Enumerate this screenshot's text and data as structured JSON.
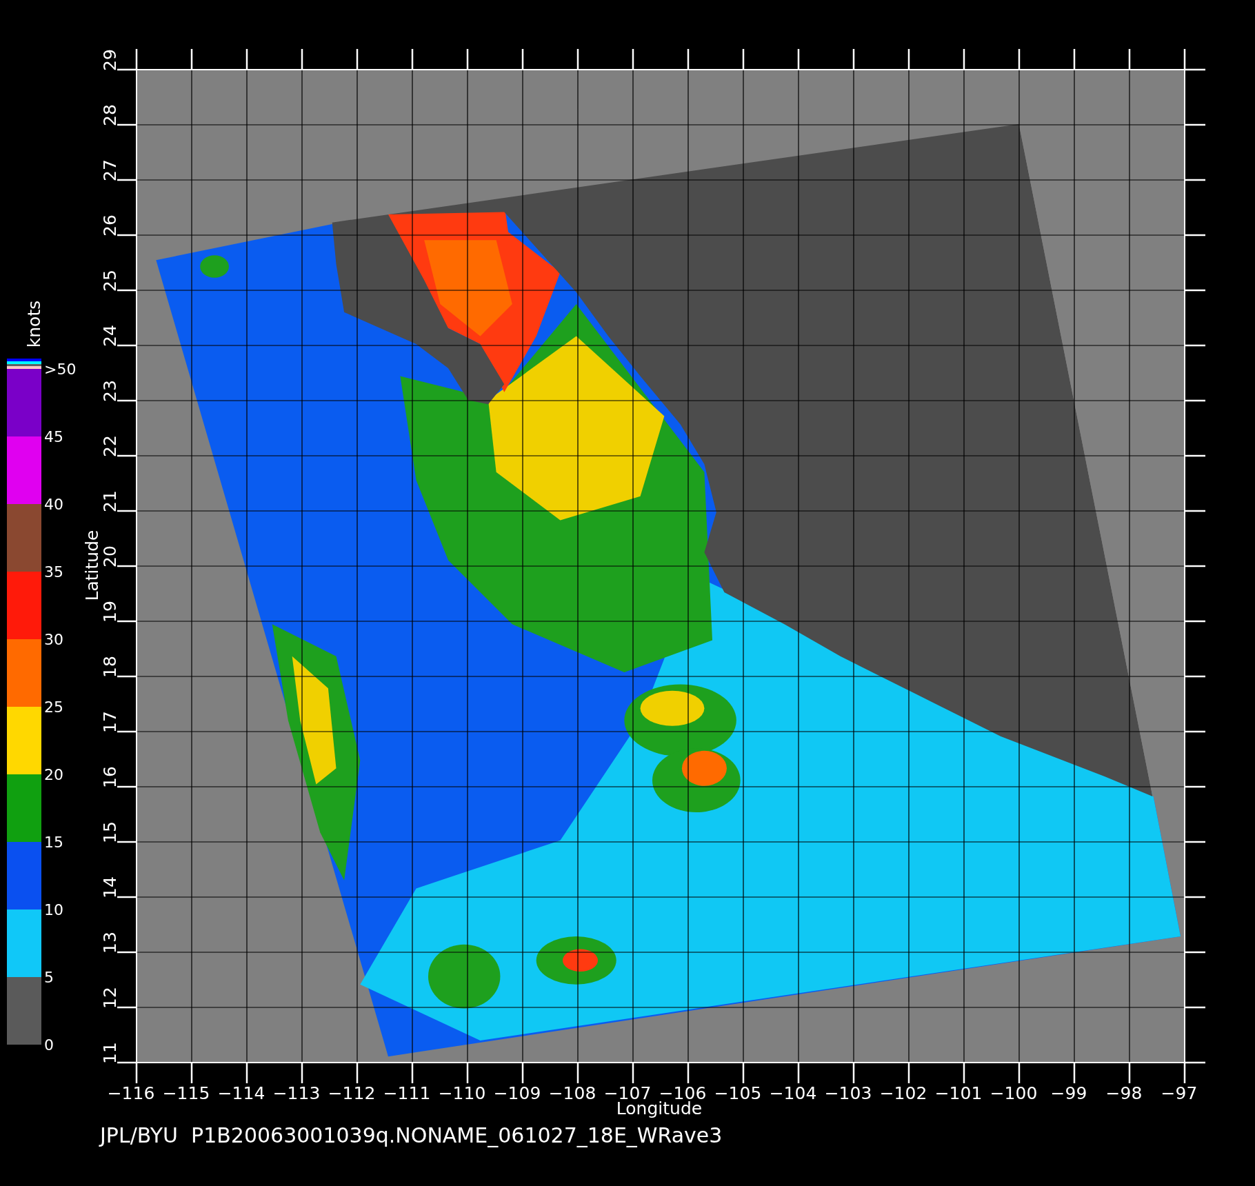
{
  "colorbar": {
    "unit": "knots",
    "labels": [
      ">50",
      "45",
      "40",
      "35",
      "30",
      "25",
      "20",
      "15",
      "10",
      "5",
      "0"
    ],
    "segments": [
      {
        "color": "#7a00c8"
      },
      {
        "color": "#e000f0"
      },
      {
        "color": "#8a4830"
      },
      {
        "color": "#ff1a0a"
      },
      {
        "color": "#ff6a00"
      },
      {
        "color": "#ffd800"
      },
      {
        "color": "#10a010"
      },
      {
        "color": "#0a50f0"
      },
      {
        "color": "#10c8f8"
      },
      {
        "color": "#5a5a5a"
      }
    ]
  },
  "y_axis": {
    "label": "Latitude",
    "ticks": [
      "11",
      "12",
      "13",
      "14",
      "15",
      "16",
      "17",
      "18",
      "19",
      "20",
      "21",
      "22",
      "23",
      "24",
      "25",
      "26",
      "27",
      "28",
      "29"
    ]
  },
  "x_axis": {
    "label": "Longitude",
    "ticks": [
      "−116",
      "−115",
      "−114",
      "−113",
      "−112",
      "−111",
      "−110",
      "−109",
      "−108",
      "−107",
      "−106",
      "−105",
      "−104",
      "−103",
      "−102",
      "−101",
      "−100",
      "−99",
      "−98",
      "−97"
    ]
  },
  "footer": "JPL/BYU  P1B20063001039q.NONAME_061027_18E_WRave3"
}
